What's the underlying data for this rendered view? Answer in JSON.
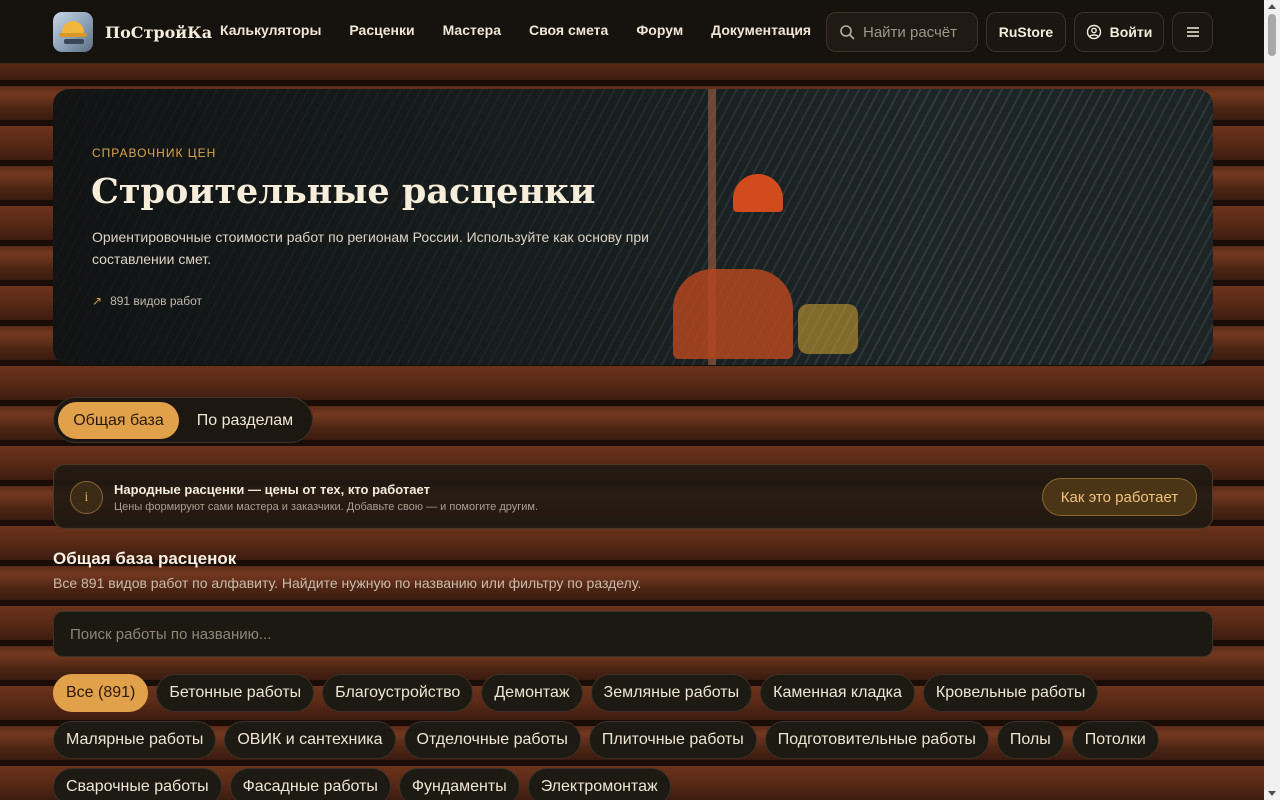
{
  "brand": {
    "name": "ПоСтройКа"
  },
  "nav": [
    "Калькуляторы",
    "Расценки",
    "Мастера",
    "Своя смета",
    "Форум",
    "Документация"
  ],
  "header": {
    "search_placeholder": "Найти расчёт",
    "rustore_label": "RuStore",
    "login_label": "Войти"
  },
  "hero": {
    "kicker": "СПРАВОЧНИК ЦЕН",
    "title": "Строительные расценки",
    "description": "Ориентировочные стоимости работ по регионам России. Используйте как основу при составлении смет.",
    "stat": "891 видов работ"
  },
  "tabs": [
    "Общая база",
    "По разделам"
  ],
  "info": {
    "title": "Народные расценки — цены от тех, кто работает",
    "subtitle": "Цены формируют сами мастера и заказчики. Добавьте свою — и помогите другим.",
    "button": "Как это работает"
  },
  "section": {
    "title": "Общая база расценок",
    "subtitle": "Все 891 видов работ по алфавиту. Найдите нужную по названию или фильтру по разделу.",
    "search_placeholder": "Поиск работы по названию..."
  },
  "chips": [
    "Все (891)",
    "Бетонные работы",
    "Благоустройство",
    "Демонтаж",
    "Земляные работы",
    "Каменная кладка",
    "Кровельные работы",
    "Малярные работы",
    "ОВИК и сантехника",
    "Отделочные работы",
    "Плиточные работы",
    "Подготовительные работы",
    "Полы",
    "Потолки",
    "Сварочные работы",
    "Фасадные работы",
    "Фундаменты",
    "Электромонтаж"
  ],
  "colors": {
    "accent": "#e0a14a",
    "background": "#16120d"
  }
}
